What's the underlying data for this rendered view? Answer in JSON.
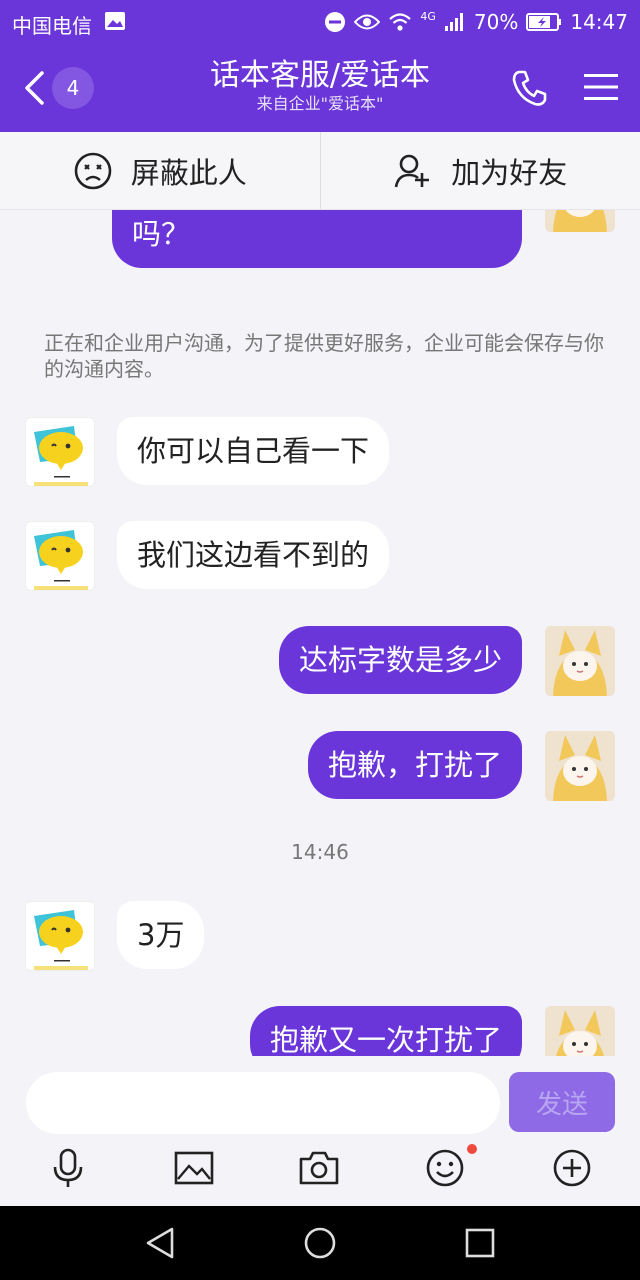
{
  "status_bar": {
    "carrier": "中国电信",
    "network": "4G",
    "battery": "70%",
    "time": "14:47"
  },
  "nav": {
    "unread_count": "4",
    "title": "话本客服/爱话本",
    "subtitle": "来自企业\"爱话本\""
  },
  "actions": {
    "block_label": "屏蔽此人",
    "add_friend_label": "加为好友"
  },
  "messages": [
    {
      "side": "right",
      "text": "请问一下，我的书字数够吗？"
    },
    {
      "side": "left",
      "text": "你可以自己看一下"
    },
    {
      "side": "left",
      "text": "我们这边看不到的"
    },
    {
      "side": "right",
      "text": "达标字数是多少"
    },
    {
      "side": "right",
      "text": "抱歉，打扰了"
    },
    {
      "side": "left",
      "text": "3万"
    },
    {
      "side": "right",
      "text": "抱歉又一次打扰了"
    }
  ],
  "notice": "正在和企业用户沟通，为了提供更好服务，企业可能会保存与你的沟通内容。",
  "timestamp": "14:46",
  "input": {
    "value": "",
    "send_label": "发送"
  },
  "toolbar_icons": [
    "microphone-icon",
    "image-icon",
    "camera-icon",
    "emoji-icon",
    "plus-icon"
  ],
  "colors": {
    "brand": "#6a35d9",
    "send_button": "#8f6ae6",
    "badge_dot": "#f04a3c"
  }
}
